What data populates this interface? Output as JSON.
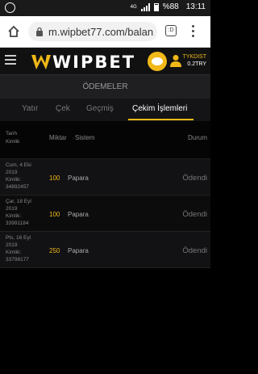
{
  "status_bar": {
    "network": "4G",
    "battery": "%88",
    "time": "13:11"
  },
  "browser": {
    "url": "m.wipbet77.com/balan",
    "tabs_count": ":D"
  },
  "site": {
    "logo_text": "WIPBET",
    "username": "TYKDIST",
    "balance": "0.2TRY"
  },
  "section_title": "ÖDEMELER",
  "tabs": [
    {
      "label": "Yatır"
    },
    {
      "label": "Çek"
    },
    {
      "label": "Geçmiş"
    },
    {
      "label": "Çekim İşlemleri"
    }
  ],
  "table": {
    "headers": {
      "date_line1": "Tarih",
      "date_line2": "Kimlik",
      "amount": "Miktar",
      "system": "Sistem",
      "status": "Durum"
    },
    "rows": [
      {
        "date": "Cum, 4 Eki 2019",
        "id_label": "Kimlik:",
        "id": "34892457",
        "amount": "100",
        "system": "Papara",
        "status": "Ödendi"
      },
      {
        "date": "Çar, 18 Eyl 2019",
        "id_label": "Kimlik:",
        "id": "33991184",
        "amount": "100",
        "system": "Papara",
        "status": "Ödendi"
      },
      {
        "date": "Pts, 16 Eyl 2019",
        "id_label": "Kimlik:",
        "id": "33798177",
        "amount": "250",
        "system": "Papara",
        "status": "Ödendi"
      }
    ]
  },
  "colors": {
    "accent": "#f0b818",
    "background": "#000000"
  }
}
